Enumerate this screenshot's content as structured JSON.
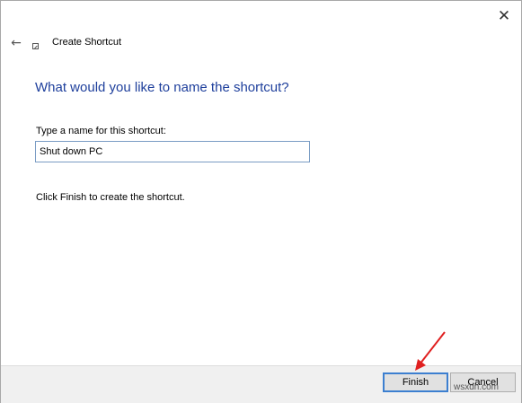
{
  "window": {
    "title": "Create Shortcut",
    "close_glyph": "✕",
    "back_glyph": "←"
  },
  "main": {
    "heading": "What would you like to name the shortcut?",
    "field_label": "Type a name for this shortcut:",
    "name_value": "Shut down PC",
    "hint": "Click Finish to create the shortcut."
  },
  "footer": {
    "finish_label": "Finish",
    "cancel_label": "Cancel"
  },
  "annotation": {
    "arrow_color": "#e02020"
  },
  "watermark": "wsxdn.com"
}
